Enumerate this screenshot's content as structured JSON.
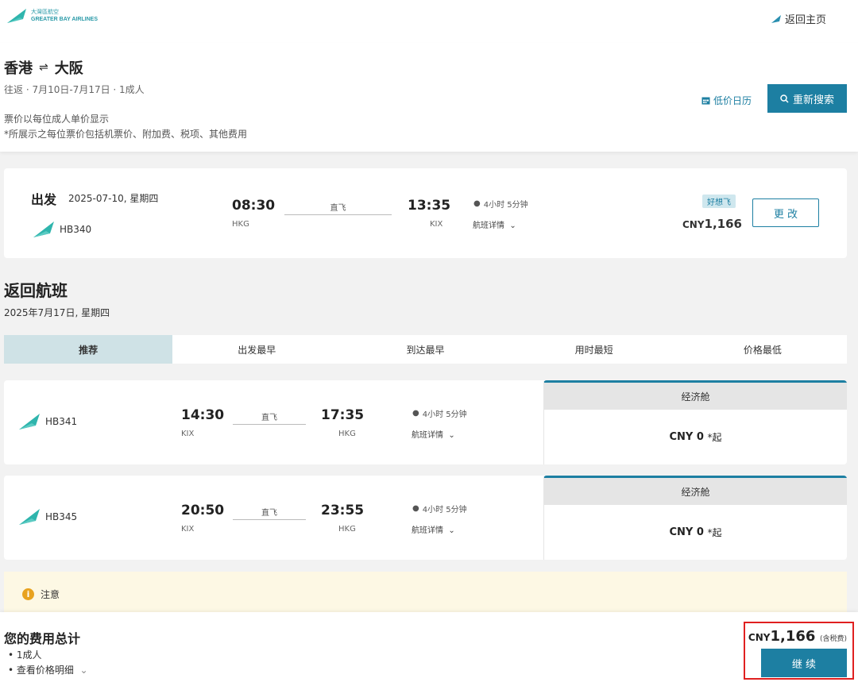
{
  "header": {
    "logo_cn": "大灣區航空",
    "logo_en": "GREATER BAY AIRLINES",
    "home_link": "返回主页"
  },
  "search_summary": {
    "origin": "香港",
    "swap_symbol": "⇌",
    "destination": "大阪",
    "trip_meta": "往返 · 7月10日-7月17日 · 1成人",
    "note_line1": "票价以每位成人单价显示",
    "note_line2": "*所展示之每位票价包括机票价、附加费、税项、其他费用",
    "calendar_link": "低价日历",
    "research_button": "重新搜索"
  },
  "outbound": {
    "label": "出发",
    "date": "2025-07-10, 星期四",
    "flight_no": "HB340",
    "depart_time": "08:30",
    "depart_code": "HKG",
    "stop_label": "直飞",
    "arrive_time": "13:35",
    "arrive_code": "KIX",
    "duration": "4小时 5分钟",
    "details_link": "航班详情",
    "badge": "好想飞",
    "price_currency": "CNY",
    "price_value": "1,166",
    "change_button": "更 改"
  },
  "return_section": {
    "title": "返回航班",
    "date": "2025年7月17日, 星期四",
    "sort_tabs": [
      {
        "label": "推荐",
        "active": true
      },
      {
        "label": "出发最早",
        "active": false
      },
      {
        "label": "到达最早",
        "active": false
      },
      {
        "label": "用时最短",
        "active": false
      },
      {
        "label": "价格最低",
        "active": false
      }
    ],
    "flights": [
      {
        "flight_no": "HB341",
        "depart_time": "14:30",
        "depart_code": "KIX",
        "stop_label": "直飞",
        "arrive_time": "17:35",
        "arrive_code": "HKG",
        "duration": "4小时 5分钟",
        "details_link": "航班详情",
        "cabin_name": "经济舱",
        "cabin_currency": "CNY",
        "cabin_price": "0",
        "cabin_suffix": "*起"
      },
      {
        "flight_no": "HB345",
        "depart_time": "20:50",
        "depart_code": "KIX",
        "stop_label": "直飞",
        "arrive_time": "23:55",
        "arrive_code": "HKG",
        "duration": "4小时 5分钟",
        "details_link": "航班详情",
        "cabin_name": "经济舱",
        "cabin_currency": "CNY",
        "cabin_price": "0",
        "cabin_suffix": "*起"
      }
    ]
  },
  "notice": {
    "icon": "info-icon",
    "label": "注意"
  },
  "footer": {
    "title": "您的费用总计",
    "pax": "• 1成人",
    "price_detail_link": "• 查看价格明细",
    "total_currency": "CNY",
    "total_value": "1,166",
    "tax_note": "(含税费)",
    "continue_button": "继 续"
  },
  "colors": {
    "brand": "#1d7fa2",
    "logo_teal": "#2fb5ad",
    "highlight_border": "#e02020",
    "notice_bg": "#fdf8e4"
  }
}
